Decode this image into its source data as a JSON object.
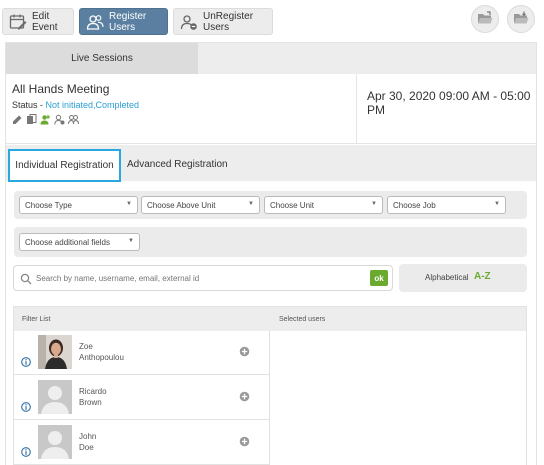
{
  "toolbar": {
    "edit_event": "Edit Event",
    "register_users": "Register Users",
    "unregister_users": "UnRegister Users",
    "right_icons": [
      "folder-open-icon",
      "folder-download-icon"
    ]
  },
  "sessions": {
    "tab": "Live Sessions"
  },
  "event": {
    "title": "All Hands Meeting",
    "status_label": "Status - ",
    "status_values": "Not initiated,Completed",
    "date_range": "Apr 30, 2020 09:00 AM - 05:00 PM",
    "icons": [
      "edit-icon",
      "duplicate-icon",
      "register-user-icon",
      "unregister-user-icon",
      "group-icon"
    ]
  },
  "tabs": {
    "individual": "Individual Registration",
    "advanced": "Advanced Registration"
  },
  "filters": {
    "type": "Choose Type",
    "above_unit": "Choose Above Unit",
    "unit": "Choose Unit",
    "job": "Choose Job",
    "additional": "Choose additional fields"
  },
  "search": {
    "placeholder": "Search by name, username, email, external id",
    "ok": "ok"
  },
  "sort": {
    "label": "Alphabetical",
    "az": "A-Z"
  },
  "lists": {
    "filter_list": "Filter List",
    "selected_users": "Selected users",
    "users": [
      {
        "first": "Zoe",
        "last": "Anthopoulou",
        "photo": true
      },
      {
        "first": "Ricardo",
        "last": "Brown",
        "photo": false
      },
      {
        "first": "John",
        "last": "Doe",
        "photo": false
      }
    ]
  },
  "colors": {
    "accent": "#5b7fa0",
    "tab_outline": "#29a8e0",
    "ok_green": "#6aab2f",
    "status_link": "#2a9fd6"
  }
}
